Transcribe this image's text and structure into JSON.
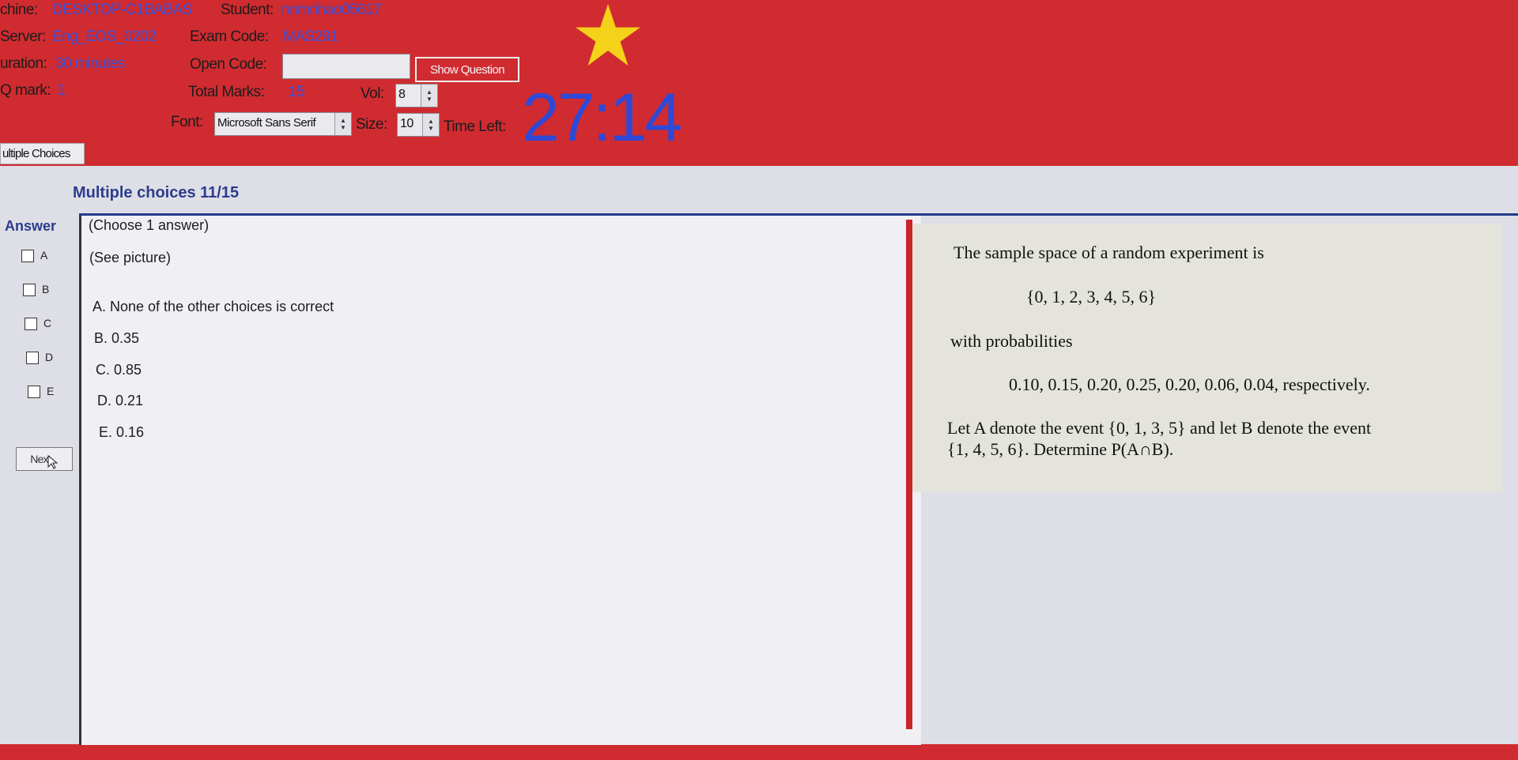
{
  "header": {
    "machine_label": "chine:",
    "machine_value": "DESKTOP-C1BABAS",
    "student_label": "Student:",
    "student_value": "nnmnhao05617",
    "server_label": "Server:",
    "server_value": "Eng_EOS_0202",
    "exam_code_label": "Exam Code:",
    "exam_code_value": "MAS291",
    "duration_label": "uration:",
    "duration_value": "30 minutes",
    "open_code_label": "Open Code:",
    "open_code_value": "",
    "show_question_label": "Show Question",
    "mark_label": "Q mark:",
    "mark_value": "1",
    "total_marks_label": "Total Marks:",
    "total_marks_value": "15",
    "vol_label": "Vol:",
    "vol_value": "8",
    "font_label": "Font:",
    "font_value": "Microsoft Sans Serif",
    "size_label": "Size:",
    "size_value": "10",
    "time_left_label": "Time Left:",
    "timer": "27:14"
  },
  "tab": {
    "label": "ultiple Choices"
  },
  "question": {
    "title": "Multiple choices 11/15",
    "answer_label": "Answer",
    "instruction": "(Choose 1 answer)",
    "see_picture": "(See picture)",
    "choices": [
      "A. None of the other choices is correct",
      "B. 0.35",
      "C. 0.85",
      "D. 0.21",
      "E. 0.16"
    ],
    "checkbox_labels": [
      "A",
      "B",
      "C",
      "D",
      "E"
    ],
    "next_label": "Next"
  },
  "picture": {
    "line1": "The sample space of a random experiment is",
    "line2": "{0, 1, 2, 3, 4, 5, 6}",
    "line3": "with probabilities",
    "line4": "0.10,  0.15,  0.20,  0.25,  0.20,  0.06, 0.04,  respectively.",
    "line5": "Let A denote the event {0, 1, 3, 5} and let B denote the event",
    "line6": "{1, 4, 5, 6}. Determine P(A∩B)."
  },
  "colors": {
    "background": "#d02b30",
    "accent_blue": "#2f49d6",
    "star": "#f4d21a"
  },
  "icons": [
    "star-icon",
    "spinner-arrows-icon",
    "cursor-icon"
  ]
}
